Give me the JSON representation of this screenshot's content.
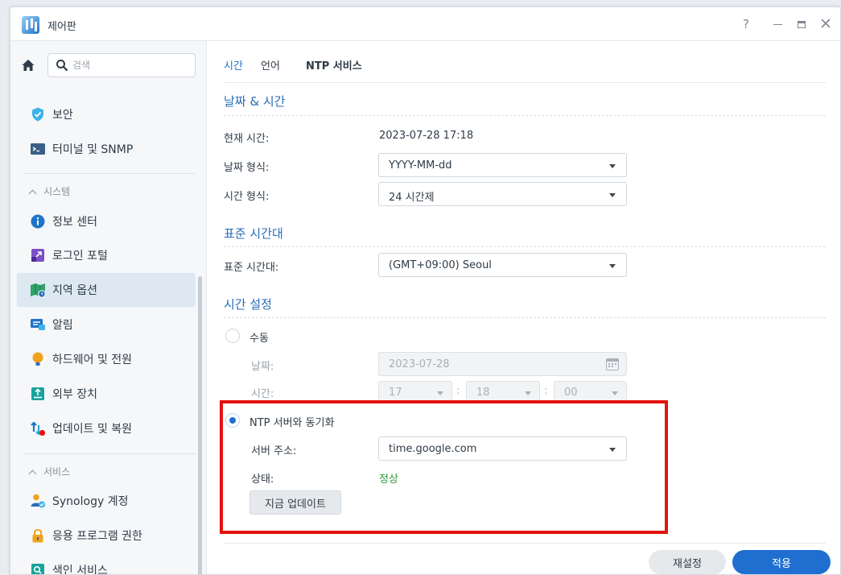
{
  "window": {
    "title": "제어판",
    "help": "?",
    "icon": "control-panel-icon"
  },
  "sidebar": {
    "search_placeholder": "검색",
    "items_top": [
      {
        "label": "보안",
        "icon": "shield-check-icon",
        "color": "#3fb2e8"
      },
      {
        "label": "터미널 및 SNMP",
        "icon": "terminal-icon",
        "color": "#3b5f86"
      }
    ],
    "section_system": "시스템",
    "items_system": [
      {
        "label": "정보 센터",
        "icon": "info-icon",
        "color": "#1e74c8"
      },
      {
        "label": "로그인 포털",
        "icon": "login-portal-icon",
        "color": "#7b4fc9"
      },
      {
        "label": "지역 옵션",
        "icon": "region-map-icon",
        "color": "#2fa36b"
      },
      {
        "label": "알림",
        "icon": "notification-icon",
        "color": "#1e74c8"
      },
      {
        "label": "하드웨어 및 전원",
        "icon": "lightbulb-icon",
        "color": "#f0a21a"
      },
      {
        "label": "외부 장치",
        "icon": "external-device-icon",
        "color": "#16a39b"
      },
      {
        "label": "업데이트 및 복원",
        "icon": "update-restore-icon",
        "color": "#1e74c8"
      }
    ],
    "section_services": "서비스",
    "items_services": [
      {
        "label": "Synology 계정",
        "icon": "synology-account-icon",
        "color": "#2a8fd8"
      },
      {
        "label": "응용 프로그램 권한",
        "icon": "lock-icon",
        "color": "#f0a21a"
      },
      {
        "label": "색인 서비스",
        "icon": "index-search-icon",
        "color": "#16a39b"
      }
    ],
    "active_item": "지역 옵션"
  },
  "tabs": [
    {
      "label": "시간"
    },
    {
      "label": "언어"
    },
    {
      "label": "NTP 서비스"
    }
  ],
  "date_time": {
    "section_title": "날짜 & 시간",
    "current_time_label": "현재 시간:",
    "current_time_value": "2023-07-28 17:18",
    "date_format_label": "날짜 형식:",
    "date_format_value": "YYYY-MM-dd",
    "time_format_label": "시간 형식:",
    "time_format_value": "24 시간제"
  },
  "timezone": {
    "section_title": "표준 시간대",
    "label": "표준 시간대:",
    "value": "(GMT+09:00) Seoul"
  },
  "time_setting": {
    "section_title": "시간 설정",
    "manual_label": "수동",
    "date_label": "날짜:",
    "date_value": "2023-07-28",
    "time_label": "시간:",
    "hour": "17",
    "minute": "18",
    "second": "00",
    "colon": ":",
    "ntp_label": "NTP 서버와 동기화",
    "server_label": "서버 주소:",
    "server_value": "time.google.com",
    "status_label": "상태:",
    "status_value": "정상",
    "update_button": "지금 업데이트"
  },
  "footer": {
    "reset_button": "재설정",
    "apply_button": "적용"
  },
  "colors": {
    "accent": "#1f6fd1",
    "highlight": "#e3120f",
    "status_ok": "#2e9d3a"
  }
}
